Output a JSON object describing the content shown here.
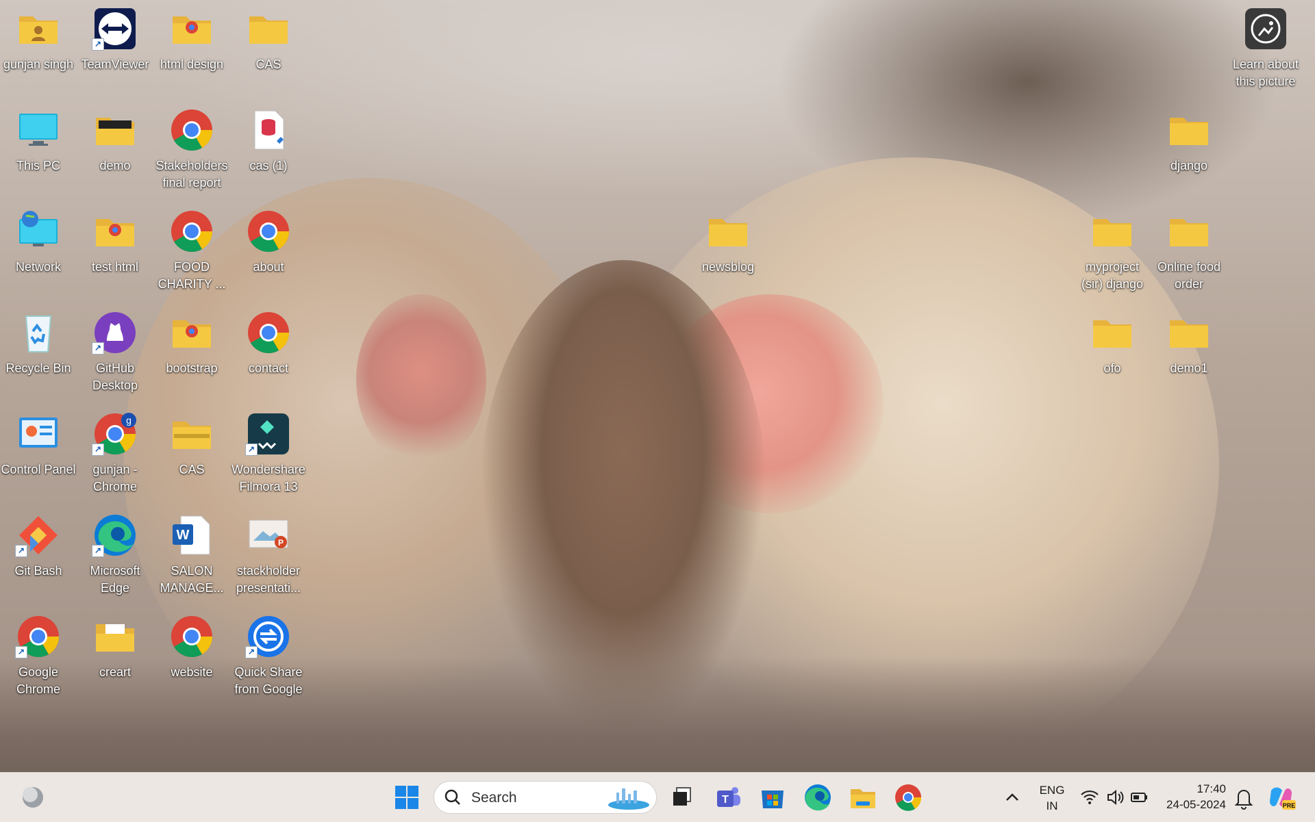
{
  "desktop": {
    "icons": [
      {
        "name": "folder-gunjan-singh",
        "label1": "gunjan singh",
        "label2": ""
      },
      {
        "name": "teamviewer",
        "label1": "TeamViewer",
        "label2": ""
      },
      {
        "name": "folder-html-design",
        "label1": "html design",
        "label2": ""
      },
      {
        "name": "folder-cas",
        "label1": "CAS",
        "label2": ""
      },
      {
        "name": "this-pc",
        "label1": "This PC",
        "label2": ""
      },
      {
        "name": "folder-demo",
        "label1": "demo",
        "label2": ""
      },
      {
        "name": "stakeholders-final-report",
        "label1": "Stakeholders",
        "label2": "final report"
      },
      {
        "name": "file-cas-1",
        "label1": "cas (1)",
        "label2": ""
      },
      {
        "name": "network",
        "label1": "Network",
        "label2": ""
      },
      {
        "name": "folder-test-html",
        "label1": "test html",
        "label2": ""
      },
      {
        "name": "food-charity",
        "label1": "FOOD",
        "label2": "CHARITY ..."
      },
      {
        "name": "about",
        "label1": "about",
        "label2": ""
      },
      {
        "name": "recycle-bin",
        "label1": "Recycle Bin",
        "label2": ""
      },
      {
        "name": "github-desktop",
        "label1": "GitHub",
        "label2": "Desktop"
      },
      {
        "name": "folder-bootstrap",
        "label1": "bootstrap",
        "label2": ""
      },
      {
        "name": "contact",
        "label1": "contact",
        "label2": ""
      },
      {
        "name": "control-panel",
        "label1": "Control Panel",
        "label2": ""
      },
      {
        "name": "gunjan-chrome",
        "label1": "gunjan -",
        "label2": "Chrome"
      },
      {
        "name": "archive-cas",
        "label1": "CAS",
        "label2": ""
      },
      {
        "name": "wondershare-filmora",
        "label1": "Wondershare",
        "label2": "Filmora 13"
      },
      {
        "name": "git-bash",
        "label1": "Git Bash",
        "label2": ""
      },
      {
        "name": "microsoft-edge",
        "label1": "Microsoft",
        "label2": "Edge"
      },
      {
        "name": "salon-manage",
        "label1": "SALON",
        "label2": "MANAGE..."
      },
      {
        "name": "stackholder-presentation",
        "label1": "stackholder",
        "label2": "presentati..."
      },
      {
        "name": "google-chrome",
        "label1": "Google",
        "label2": "Chrome"
      },
      {
        "name": "folder-creart",
        "label1": "creart",
        "label2": ""
      },
      {
        "name": "website",
        "label1": "website",
        "label2": ""
      },
      {
        "name": "quick-share",
        "label1": "Quick Share",
        "label2": "from Google"
      },
      {
        "name": "folder-newsblog",
        "label1": "newsblog",
        "label2": ""
      },
      {
        "name": "learn-about-picture",
        "label1": "Learn about",
        "label2": "this picture"
      },
      {
        "name": "folder-django",
        "label1": "django",
        "label2": ""
      },
      {
        "name": "folder-myproject-django",
        "label1": "myproject",
        "label2": "(sir) django"
      },
      {
        "name": "folder-online-food-order",
        "label1": "Online food",
        "label2": "order"
      },
      {
        "name": "folder-ofo",
        "label1": "ofo",
        "label2": ""
      },
      {
        "name": "folder-demo1",
        "label1": "demo1",
        "label2": ""
      }
    ]
  },
  "taskbar": {
    "search_placeholder": "Search",
    "apps": [
      "widgets-icon",
      "start-icon",
      "task-view-icon",
      "teams-icon",
      "microsoft-store-icon",
      "edge-icon",
      "file-explorer-icon",
      "chrome-icon"
    ],
    "language": "ENG",
    "region": "IN",
    "time": "17:40",
    "date": "24-05-2024"
  },
  "colors": {
    "folder": "#f5c842",
    "chrome_red": "#db4437",
    "chrome_yellow": "#f4c20d",
    "chrome_green": "#0f9d58",
    "chrome_blue": "#4285f4",
    "taskbar_bg": "#eee9e6"
  }
}
